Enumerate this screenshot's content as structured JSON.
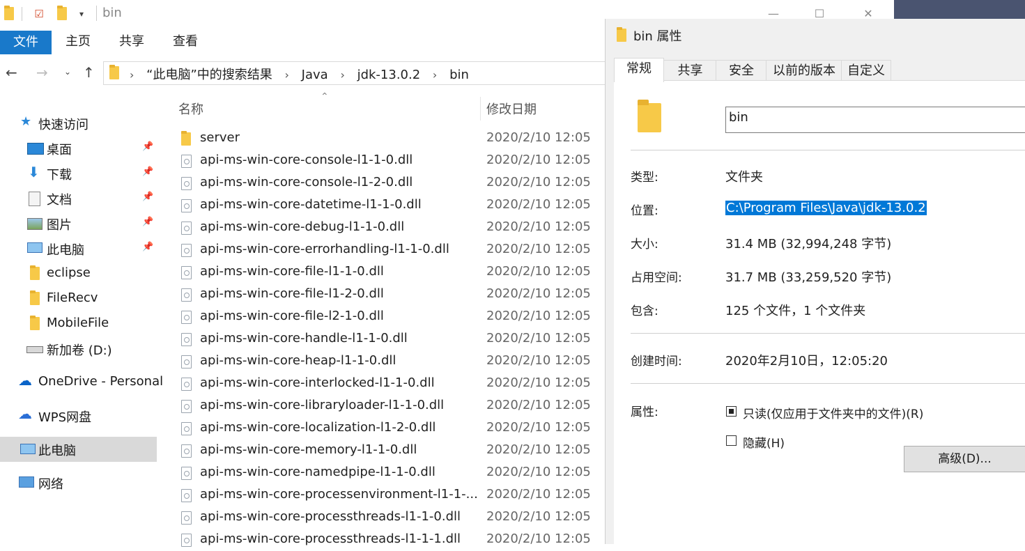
{
  "explorer": {
    "title": "bin",
    "window_controls": [
      "—",
      "☐",
      "✕"
    ],
    "ribbon_tabs": [
      "文件",
      "主页",
      "共享",
      "查看"
    ],
    "breadcrumbs": [
      "“此电脑”中的搜索结果",
      "Java",
      "jdk-13.0.2",
      "bin"
    ],
    "nav_items": [
      {
        "label": "快速访问",
        "icon": "star-icon"
      },
      {
        "label": "桌面",
        "icon": "desktop-icon",
        "pinned": true
      },
      {
        "label": "下载",
        "icon": "download-icon",
        "pinned": true
      },
      {
        "label": "文档",
        "icon": "document-icon",
        "pinned": true
      },
      {
        "label": "图片",
        "icon": "pictures-icon",
        "pinned": true
      },
      {
        "label": "此电脑",
        "icon": "computer-icon",
        "pinned": true
      },
      {
        "label": "eclipse",
        "icon": "folder-icon"
      },
      {
        "label": "FileRecv",
        "icon": "folder-icon"
      },
      {
        "label": "MobileFile",
        "icon": "folder-icon"
      },
      {
        "label": "新加卷 (D:)",
        "icon": "drive-icon"
      },
      {
        "label": "OneDrive - Personal",
        "icon": "onedrive-icon"
      },
      {
        "label": "WPS网盘",
        "icon": "cloud-icon"
      },
      {
        "label": "此电脑",
        "icon": "computer-icon",
        "selected": true
      },
      {
        "label": "网络",
        "icon": "network-icon"
      }
    ],
    "columns": {
      "name": "名称",
      "date": "修改日期"
    },
    "files": [
      {
        "name": "server",
        "type": "folder",
        "date": "2020/2/10 12:05"
      },
      {
        "name": "api-ms-win-core-console-l1-1-0.dll",
        "type": "dll",
        "date": "2020/2/10 12:05"
      },
      {
        "name": "api-ms-win-core-console-l1-2-0.dll",
        "type": "dll",
        "date": "2020/2/10 12:05"
      },
      {
        "name": "api-ms-win-core-datetime-l1-1-0.dll",
        "type": "dll",
        "date": "2020/2/10 12:05"
      },
      {
        "name": "api-ms-win-core-debug-l1-1-0.dll",
        "type": "dll",
        "date": "2020/2/10 12:05"
      },
      {
        "name": "api-ms-win-core-errorhandling-l1-1-0.dll",
        "type": "dll",
        "date": "2020/2/10 12:05"
      },
      {
        "name": "api-ms-win-core-file-l1-1-0.dll",
        "type": "dll",
        "date": "2020/2/10 12:05"
      },
      {
        "name": "api-ms-win-core-file-l1-2-0.dll",
        "type": "dll",
        "date": "2020/2/10 12:05"
      },
      {
        "name": "api-ms-win-core-file-l2-1-0.dll",
        "type": "dll",
        "date": "2020/2/10 12:05"
      },
      {
        "name": "api-ms-win-core-handle-l1-1-0.dll",
        "type": "dll",
        "date": "2020/2/10 12:05"
      },
      {
        "name": "api-ms-win-core-heap-l1-1-0.dll",
        "type": "dll",
        "date": "2020/2/10 12:05"
      },
      {
        "name": "api-ms-win-core-interlocked-l1-1-0.dll",
        "type": "dll",
        "date": "2020/2/10 12:05"
      },
      {
        "name": "api-ms-win-core-libraryloader-l1-1-0.dll",
        "type": "dll",
        "date": "2020/2/10 12:05"
      },
      {
        "name": "api-ms-win-core-localization-l1-2-0.dll",
        "type": "dll",
        "date": "2020/2/10 12:05"
      },
      {
        "name": "api-ms-win-core-memory-l1-1-0.dll",
        "type": "dll",
        "date": "2020/2/10 12:05"
      },
      {
        "name": "api-ms-win-core-namedpipe-l1-1-0.dll",
        "type": "dll",
        "date": "2020/2/10 12:05"
      },
      {
        "name": "api-ms-win-core-processenvironment-l1-1-...",
        "type": "dll",
        "date": "2020/2/10 12:05"
      },
      {
        "name": "api-ms-win-core-processthreads-l1-1-0.dll",
        "type": "dll",
        "date": "2020/2/10 12:05"
      },
      {
        "name": "api-ms-win-core-processthreads-l1-1-1.dll",
        "type": "dll",
        "date": "2020/2/10 12:05"
      }
    ]
  },
  "dialog": {
    "title": "bin 属性",
    "tabs": [
      "常规",
      "共享",
      "安全",
      "以前的版本",
      "自定义"
    ],
    "active_tab": "常规",
    "name_value": "bin",
    "props": {
      "type_label": "类型:",
      "type_value": "文件夹",
      "location_label": "位置:",
      "location_value": "C:\\Program Files\\Java\\jdk-13.0.2",
      "size_label": "大小:",
      "size_value": "31.4 MB (32,994,248 字节)",
      "disk_label": "占用空间:",
      "disk_value": "31.7 MB (33,259,520 字节)",
      "contains_label": "包含:",
      "contains_value": "125 个文件，1 个文件夹",
      "created_label": "创建时间:",
      "created_value": "2020年2月10日，12:05:20",
      "attr_label": "属性:"
    },
    "readonly_label": "只读(仅应用于文件夹中的文件)(R)",
    "readonly_state": "indeterminate",
    "hidden_label": "隐藏(H)",
    "hidden_checked": false,
    "advanced_button": "高级(D)..."
  },
  "colors": {
    "accent": "#1979ca",
    "selection": "#0078d7",
    "folder": "#f7c948"
  }
}
